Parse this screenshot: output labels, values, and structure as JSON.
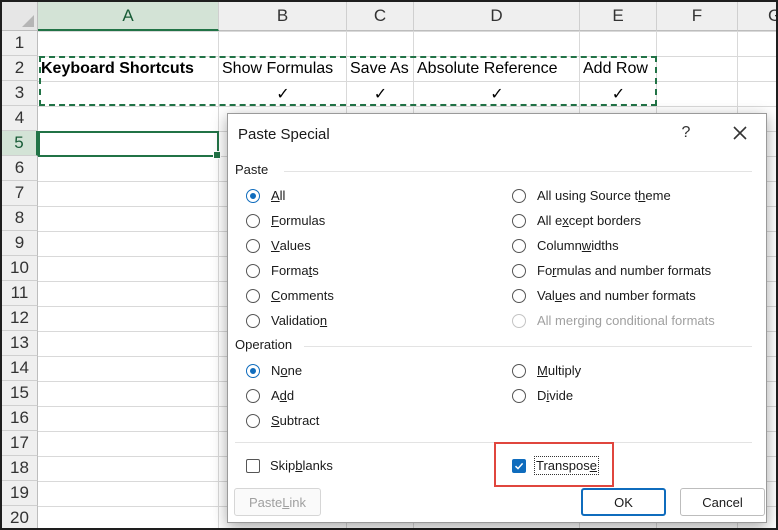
{
  "columns": [
    "A",
    "B",
    "C",
    "D",
    "E",
    "F",
    "G"
  ],
  "rows": [
    "1",
    "2",
    "3",
    "4",
    "5",
    "6",
    "7",
    "8",
    "9",
    "10",
    "11",
    "12",
    "13",
    "14",
    "15",
    "16",
    "17",
    "18",
    "19",
    "20"
  ],
  "cells": {
    "a2": "Keyboard Shortcuts",
    "b2": "Show Formulas",
    "c2": "Save As",
    "d2": "Absolute Reference",
    "e2": "Add Row",
    "b3": "✓",
    "c3": "✓",
    "d3": "✓",
    "e3": "✓"
  },
  "dialog": {
    "title": "Paste Special",
    "help": "?",
    "paste_section": "Paste",
    "paste_left": [
      {
        "pre": "",
        "key": "A",
        "post": "ll",
        "checked": true
      },
      {
        "pre": "",
        "key": "F",
        "post": "ormulas",
        "checked": false
      },
      {
        "pre": "",
        "key": "V",
        "post": "alues",
        "checked": false
      },
      {
        "pre": "Forma",
        "key": "t",
        "post": "s",
        "checked": false
      },
      {
        "pre": "",
        "key": "C",
        "post": "omments",
        "checked": false
      },
      {
        "pre": "Validatio",
        "key": "n",
        "post": "",
        "checked": false
      }
    ],
    "paste_right": [
      {
        "pre": "All using Source t",
        "key": "h",
        "post": "eme",
        "checked": false
      },
      {
        "pre": "All e",
        "key": "x",
        "post": "cept borders",
        "checked": false
      },
      {
        "pre": "Column ",
        "key": "w",
        "post": "idths",
        "checked": false
      },
      {
        "pre": "Fo",
        "key": "r",
        "post": "mulas and number formats",
        "checked": false
      },
      {
        "pre": "Val",
        "key": "u",
        "post": "es and number formats",
        "checked": false
      },
      {
        "pre": "All merging conditional formats",
        "key": "",
        "post": "",
        "checked": false,
        "disabled": true
      }
    ],
    "operation_section": "Operation",
    "operation_left": [
      {
        "pre": "N",
        "key": "o",
        "post": "ne",
        "checked": true
      },
      {
        "pre": "A",
        "key": "d",
        "post": "d",
        "checked": false
      },
      {
        "pre": "",
        "key": "S",
        "post": "ubtract",
        "checked": false
      }
    ],
    "operation_right": [
      {
        "pre": "",
        "key": "M",
        "post": "ultiply",
        "checked": false
      },
      {
        "pre": "D",
        "key": "i",
        "post": "vide",
        "checked": false
      }
    ],
    "skip_blanks": {
      "pre": "Skip ",
      "key": "b",
      "post": "lanks",
      "checked": false
    },
    "transpose": {
      "pre": "Transpos",
      "key": "e",
      "post": "",
      "checked": true
    },
    "paste_link": {
      "pre": "Paste ",
      "key": "L",
      "post": "ink"
    },
    "ok": "OK",
    "cancel": "Cancel"
  },
  "colors": {
    "excel_green": "#217346",
    "accent_blue": "#0f6cbd",
    "highlight_red": "#e0463e"
  }
}
